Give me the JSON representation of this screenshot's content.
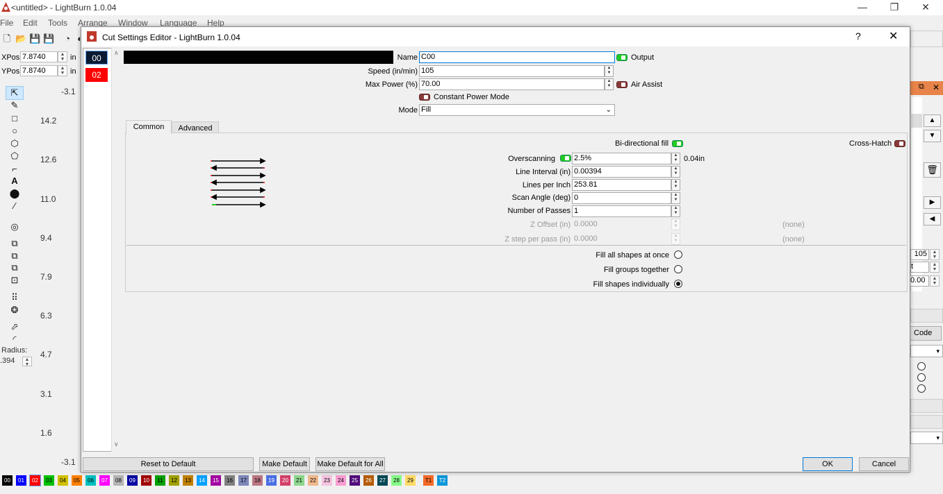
{
  "main_window": {
    "title": "<untitled> - LightBurn 1.0.04",
    "menu": [
      "File",
      "Edit",
      "Tools",
      "Arrange",
      "Window",
      "Language",
      "Help"
    ],
    "xpos_label": "XPos",
    "xpos_value": "7.8740",
    "ypos_label": "YPos",
    "ypos_value": "7.8740",
    "pos_unit": "in",
    "radius_label": "Radius:",
    "radius_value": ".394",
    "ruler_ticks": [
      "-3.1",
      "14.2",
      "12.6",
      "11.0",
      "9.4",
      "7.9",
      "6.3",
      "4.7",
      "3.1",
      "1.6",
      "-3.1"
    ],
    "palette": [
      {
        "label": "00",
        "color": "#000000",
        "text": "#ffffff"
      },
      {
        "label": "01",
        "color": "#0000ff",
        "text": "#ffffff"
      },
      {
        "label": "02",
        "color": "#ff0000",
        "text": "#ffffff"
      },
      {
        "label": "03",
        "color": "#00c000",
        "text": "#000000"
      },
      {
        "label": "04",
        "color": "#d0c000",
        "text": "#000000"
      },
      {
        "label": "05",
        "color": "#ff8000",
        "text": "#000000"
      },
      {
        "label": "06",
        "color": "#00c0c0",
        "text": "#000000"
      },
      {
        "label": "07",
        "color": "#ff00ff",
        "text": "#ffffff"
      },
      {
        "label": "08",
        "color": "#b4b4b4",
        "text": "#000000"
      },
      {
        "label": "09",
        "color": "#0000a0",
        "text": "#ffffff"
      },
      {
        "label": "10",
        "color": "#a00000",
        "text": "#ffffff"
      },
      {
        "label": "11",
        "color": "#00a000",
        "text": "#000000"
      },
      {
        "label": "12",
        "color": "#a0a000",
        "text": "#000000"
      },
      {
        "label": "13",
        "color": "#c08000",
        "text": "#000000"
      },
      {
        "label": "14",
        "color": "#00a0ff",
        "text": "#ffffff"
      },
      {
        "label": "15",
        "color": "#a000a0",
        "text": "#ffffff"
      },
      {
        "label": "16",
        "color": "#808080",
        "text": "#000000"
      },
      {
        "label": "17",
        "color": "#7d87b9",
        "text": "#000000"
      },
      {
        "label": "18",
        "color": "#bb7784",
        "text": "#000000"
      },
      {
        "label": "19",
        "color": "#4a6fe3",
        "text": "#ffffff"
      },
      {
        "label": "20",
        "color": "#d33f6a",
        "text": "#ffffff"
      },
      {
        "label": "21",
        "color": "#8cd78c",
        "text": "#000000"
      },
      {
        "label": "22",
        "color": "#f0b98d",
        "text": "#000000"
      },
      {
        "label": "23",
        "color": "#f6c4e1",
        "text": "#000000"
      },
      {
        "label": "24",
        "color": "#fa9ed4",
        "text": "#000000"
      },
      {
        "label": "25",
        "color": "#500a78",
        "text": "#ffffff"
      },
      {
        "label": "26",
        "color": "#b45a00",
        "text": "#ffffff"
      },
      {
        "label": "27",
        "color": "#004754",
        "text": "#ffffff"
      },
      {
        "label": "28",
        "color": "#86fa88",
        "text": "#000000"
      },
      {
        "label": "29",
        "color": "#ffdb66",
        "text": "#000000"
      },
      {
        "label": "T1",
        "color": "#f36926",
        "text": "#000000"
      },
      {
        "label": "T2",
        "color": "#0c96d9",
        "text": "#ffffff"
      }
    ],
    "right_strip": {
      "speed": "105",
      "t_label": "t",
      "value": ".0.00",
      "code": "Code"
    }
  },
  "dialog": {
    "title": "Cut Settings Editor - LightBurn 1.0.04",
    "help": "?",
    "close": "✕",
    "layers": [
      {
        "label": "00",
        "color": "#0a1a33"
      },
      {
        "label": "02",
        "color": "#ff0000"
      }
    ],
    "name_label": "Name",
    "name_value": "C00",
    "output_label": "Output",
    "speed_label": "Speed (in/min)",
    "speed_value": "105",
    "maxpower_label": "Max Power (%)",
    "maxpower_value": "70.00",
    "air_assist_label": "Air Assist",
    "constant_power_label": "Constant Power Mode",
    "mode_label": "Mode",
    "mode_value": "Fill",
    "tabs": [
      "Common",
      "Advanced"
    ],
    "bidir_label": "Bi-directional fill",
    "crosshatch_label": "Cross-Hatch",
    "overscan_label": "Overscanning",
    "overscan_value": "2.5%",
    "overscan_calc": "0.04in",
    "interval_label": "Line Interval (in)",
    "interval_value": "0.00394",
    "lpi_label": "Lines per Inch",
    "lpi_value": "253.81",
    "angle_label": "Scan Angle (deg)",
    "angle_value": "0",
    "passes_label": "Number of Passes",
    "passes_value": "1",
    "zoffset_label": "Z Offset (in)",
    "zoffset_value": "0.0000",
    "zoffset_note": "(none)",
    "zstep_label": "Z step per pass (in)",
    "zstep_value": "0.0000",
    "zstep_note": "(none)",
    "fill_all_label": "Fill all shapes at once",
    "fill_groups_label": "Fill groups together",
    "fill_individual_label": "Fill shapes individually",
    "reset_label": "Reset to Default",
    "make_default_label": "Make Default",
    "make_default_all_label": "Make Default for All",
    "ok_label": "OK",
    "cancel_label": "Cancel"
  }
}
